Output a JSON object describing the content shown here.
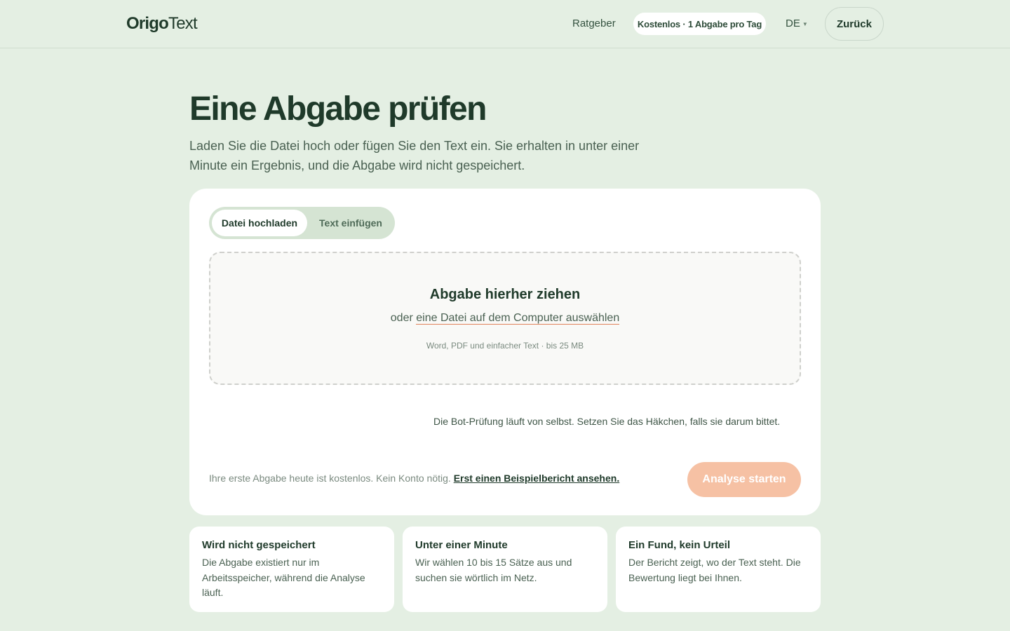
{
  "header": {
    "logo_bold": "Origo",
    "logo_light": "Text",
    "nav_link": "Ratgeber",
    "plan_badge": "Kostenlos · 1 Abgabe pro Tag",
    "language": "DE",
    "back_button": "Zurück"
  },
  "hero": {
    "title": "Eine Abgabe prüfen",
    "intro": "Laden Sie die Datei hoch oder fügen Sie den Text ein. Sie erhalten in unter einer Minute ein Ergebnis, und die Abgabe wird nicht gespeichert."
  },
  "upload": {
    "tabs": [
      {
        "label": "Datei hochladen",
        "active": true
      },
      {
        "label": "Text einfügen",
        "active": false
      }
    ],
    "dropzone_title": "Abgabe hierher ziehen",
    "dropzone_or": "oder",
    "dropzone_link": "eine Datei auf dem Computer auswählen",
    "dropzone_hint": "Word, PDF und einfacher Text · bis 25 MB",
    "bot_note": "Die Bot-Prüfung läuft von selbst. Setzen Sie das Häkchen, falls sie darum bittet.",
    "free_note": "Ihre erste Abgabe heute ist kostenlos. Kein Konto nötig.",
    "sample_link": "Erst einen Beispielbericht ansehen.",
    "start_button": "Analyse starten",
    "start_button_enabled": false
  },
  "features": [
    {
      "title": "Wird nicht gespeichert",
      "text": "Die Abgabe existiert nur im Arbeitsspeicher, während die Analyse läuft."
    },
    {
      "title": "Unter einer Minute",
      "text": "Wir wählen 10 bis 15 Sätze aus und suchen sie wörtlich im Netz."
    },
    {
      "title": "Ein Fund, kein Urteil",
      "text": "Der Bericht zeigt, wo der Text steht. Die Bewertung liegt bei Ihnen."
    }
  ],
  "colors": {
    "background": "#e4efe3",
    "text_dark": "#1f3a2a",
    "accent_disabled": "#f6c1a4",
    "link_underline": "#e0825a"
  }
}
